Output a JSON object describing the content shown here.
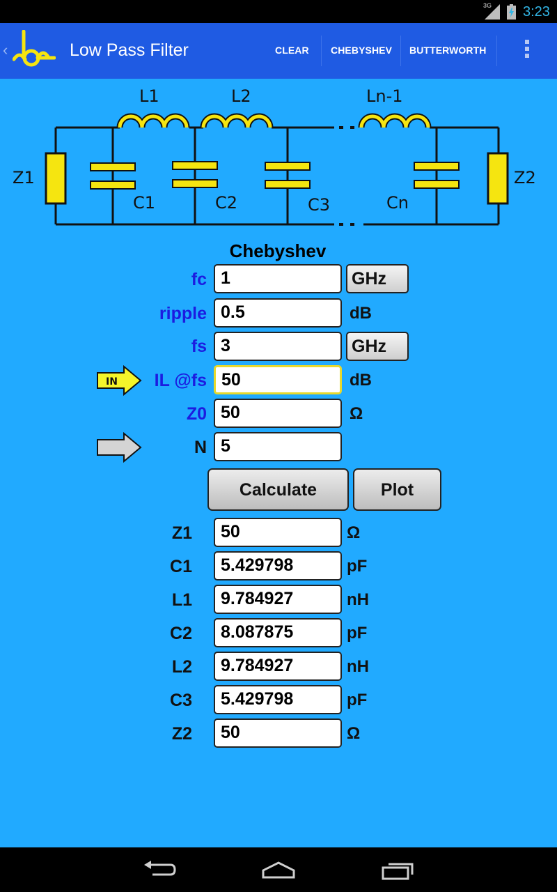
{
  "status_bar": {
    "network": "3G",
    "time": "3:23"
  },
  "action_bar": {
    "title": "Low Pass Filter",
    "actions": [
      "CLEAR",
      "CHEBYSHEV",
      "BUTTERWORTH"
    ]
  },
  "schematic": {
    "inductors": [
      "L1",
      "L2",
      "Ln-1"
    ],
    "capacitors": [
      "C1",
      "C2",
      "C3",
      "Cn"
    ],
    "impedances": [
      "Z1",
      "Z2"
    ]
  },
  "form": {
    "heading": "Chebyshev",
    "fc": {
      "label": "fc",
      "value": "1",
      "unit": "GHz"
    },
    "ripple": {
      "label": "ripple",
      "value": "0.5",
      "unit": "dB"
    },
    "fs": {
      "label": "fs",
      "value": "3",
      "unit": "GHz"
    },
    "il": {
      "label": "IL @fs",
      "value": "50",
      "unit": "dB",
      "arrow": "IN"
    },
    "z0": {
      "label": "Z0",
      "value": "50",
      "unit": "Ω"
    },
    "n": {
      "label": "N",
      "value": "5"
    },
    "calculate_label": "Calculate",
    "plot_label": "Plot"
  },
  "results": [
    {
      "label": "Z1",
      "value": "50",
      "unit": "Ω"
    },
    {
      "label": "C1",
      "value": "5.429798",
      "unit": "pF"
    },
    {
      "label": "L1",
      "value": "9.784927",
      "unit": "nH"
    },
    {
      "label": "C2",
      "value": "8.087875",
      "unit": "pF"
    },
    {
      "label": "L2",
      "value": "9.784927",
      "unit": "nH"
    },
    {
      "label": "C3",
      "value": "5.429798",
      "unit": "pF"
    },
    {
      "label": "Z2",
      "value": "50",
      "unit": "Ω"
    }
  ],
  "colors": {
    "background": "#21aaff",
    "action_bar": "#1f5be3",
    "label_blue": "#1c1ce0",
    "component_yellow": "#f5e510",
    "focus_border": "#e8d92c"
  }
}
